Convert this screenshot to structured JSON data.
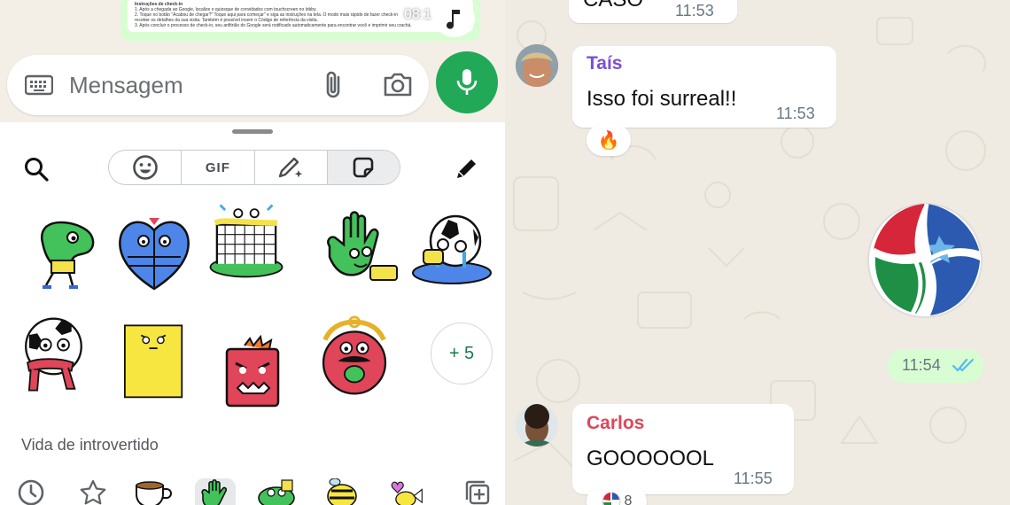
{
  "composer": {
    "preview_time": "08:1",
    "preview_doc_title": "Instruções de check-in",
    "preview_doc_lines": [
      "1. Após a chegada ao Google, localize o quiosque de convidados com touchscreen no lobby.",
      "2. Toque no botão \"Acabou de chegar?\" Toque aqui para começar\" e siga as instruções na tela. O modo mais rápido de fazer check-in",
      "   receber os detalhes da sua visita. Também é possível inserir o Código de referência da visita.",
      "3. Após concluir o processo de check-in, seu anfitrião do Google será notificado automaticamente para encontrar você e imprimir seu crachá."
    ],
    "message_placeholder": "Mensagem"
  },
  "sticker_panel": {
    "tabs": [
      "emoji",
      "GIF",
      "create-sticker",
      "stickers"
    ],
    "more_label": "+ 5",
    "pack_title": "Vida de introvertido"
  },
  "chat": {
    "messages": [
      {
        "sender": "",
        "text": "CASO",
        "time": "11:53"
      },
      {
        "sender": "Taís",
        "text": "Isso foi surreal!!",
        "time": "11:53",
        "reaction": "🔥",
        "sender_color": "#7b4fd8"
      },
      {
        "outgoing_time": "11:54"
      },
      {
        "sender": "Carlos",
        "text": "GOOOOOOL",
        "time": "11:55",
        "reaction_count": "8",
        "sender_color": "#e0455a"
      }
    ]
  },
  "colors": {
    "accent": "#21a957",
    "outgoing_bubble": "#d9fdd3",
    "chat_bg": "#efeae2",
    "read_ticks": "#53bdeb"
  }
}
